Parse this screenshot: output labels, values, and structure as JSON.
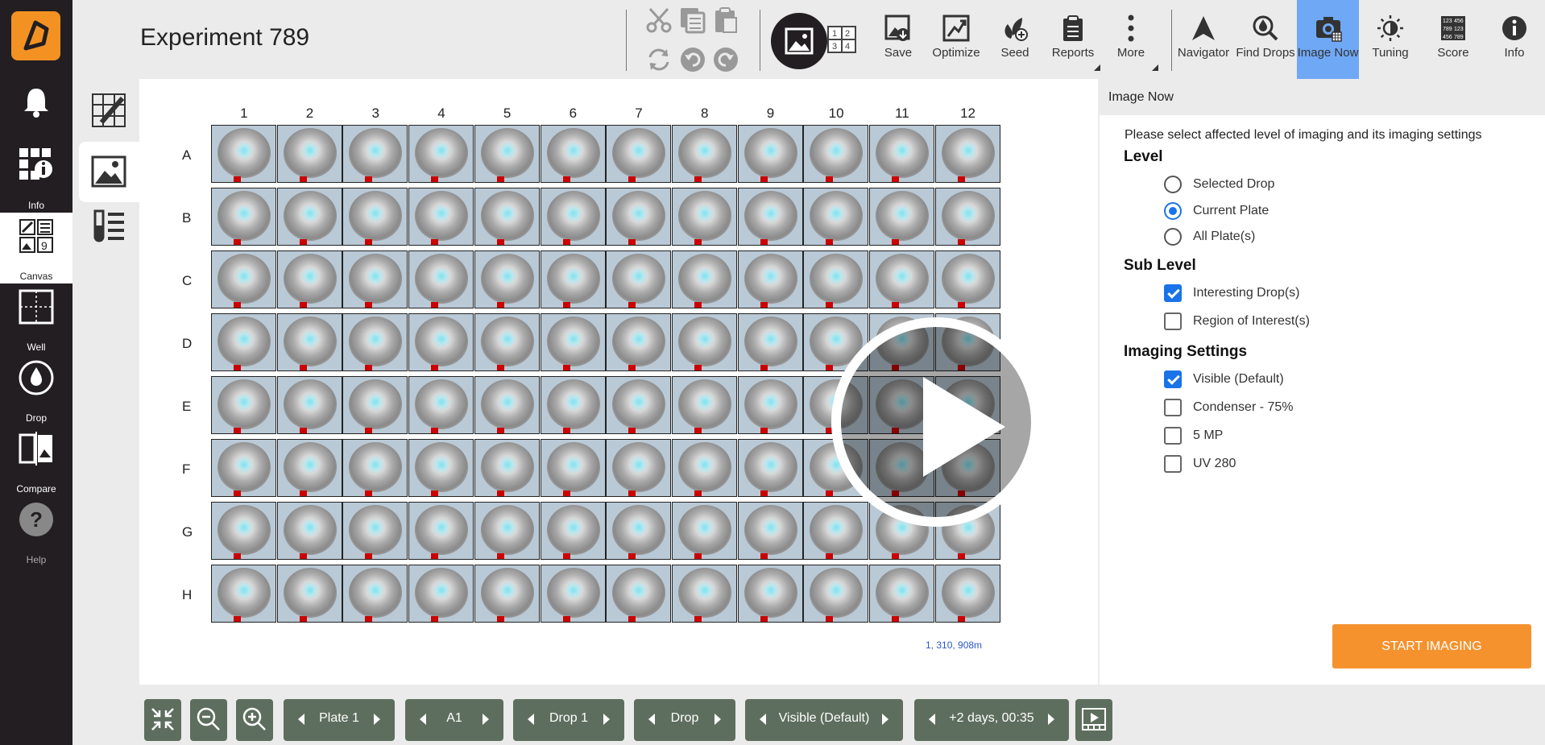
{
  "app": {
    "title": "Experiment 789"
  },
  "sidebar": {
    "items": [
      {
        "label": "",
        "icon": "bell-icon"
      },
      {
        "label": "Info",
        "icon": "info-grid-icon"
      },
      {
        "label": "Canvas",
        "icon": "canvas-icon"
      },
      {
        "label": "Well",
        "icon": "well-icon"
      },
      {
        "label": "Drop",
        "icon": "drop-icon"
      },
      {
        "label": "Compare",
        "icon": "compare-icon"
      },
      {
        "label": "Help",
        "icon": "help-icon"
      }
    ]
  },
  "toolbar": {
    "buttons": [
      {
        "label": "Save",
        "icon": "save-image-icon"
      },
      {
        "label": "Optimize",
        "icon": "optimize-icon"
      },
      {
        "label": "Seed",
        "icon": "seed-icon"
      },
      {
        "label": "Reports",
        "icon": "reports-icon"
      },
      {
        "label": "More",
        "icon": "more-icon"
      },
      {
        "label": "Navigator",
        "icon": "navigator-icon"
      },
      {
        "label": "Find Drops",
        "icon": "find-drops-icon"
      },
      {
        "label": "Image Now",
        "icon": "image-now-icon"
      },
      {
        "label": "Tuning",
        "icon": "tuning-icon"
      },
      {
        "label": "Score",
        "icon": "score-icon"
      },
      {
        "label": "Info",
        "icon": "info-icon"
      }
    ],
    "active": "Image Now",
    "accent": "#6fa8f5"
  },
  "plate": {
    "columns": [
      "1",
      "2",
      "3",
      "4",
      "5",
      "6",
      "7",
      "8",
      "9",
      "10",
      "11",
      "12"
    ],
    "rows": [
      "A",
      "B",
      "C",
      "D",
      "E",
      "F",
      "G",
      "H"
    ],
    "coords": "1, 310, 908m"
  },
  "panel": {
    "title": "Image Now",
    "description": "Please select affected level of imaging and its imaging settings",
    "level": {
      "heading": "Level",
      "options": [
        {
          "label": "Selected Drop",
          "selected": false
        },
        {
          "label": "Current Plate",
          "selected": true
        },
        {
          "label": "All Plate(s)",
          "selected": false
        }
      ]
    },
    "sublevel": {
      "heading": "Sub Level",
      "options": [
        {
          "label": "Interesting Drop(s)",
          "checked": true
        },
        {
          "label": "Region of Interest(s)",
          "checked": false
        }
      ]
    },
    "imaging": {
      "heading": "Imaging Settings",
      "options": [
        {
          "label": "Visible (Default)",
          "checked": true
        },
        {
          "label": "Condenser - 75%",
          "checked": false
        },
        {
          "label": "5 MP",
          "checked": false
        },
        {
          "label": "UV 280",
          "checked": false
        }
      ]
    },
    "start_label": "START IMAGING",
    "start_color": "#f5922e"
  },
  "bottombar": {
    "plate": "Plate 1",
    "well": "A1",
    "drop": "Drop 1",
    "mode": "Drop",
    "imaging": "Visible (Default)",
    "time": "+2 days, 00:35"
  }
}
